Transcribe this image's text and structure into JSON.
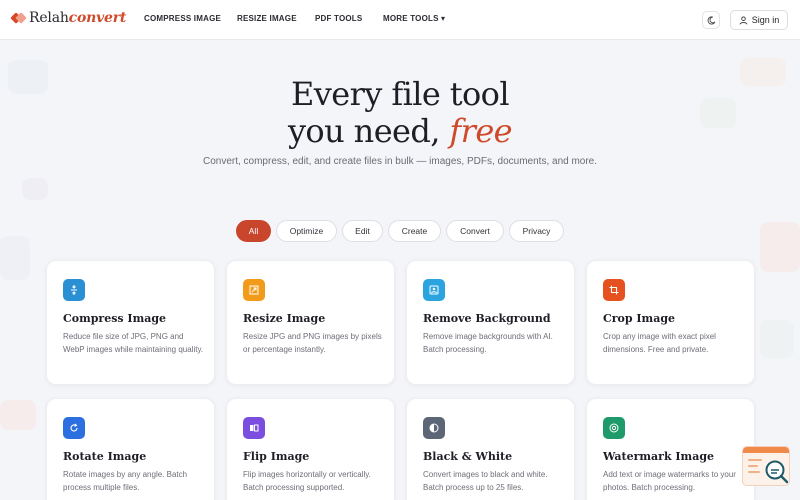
{
  "brand": {
    "name_plain": "Relah",
    "name_accent": "convert"
  },
  "nav": {
    "items": [
      "COMPRESS IMAGE",
      "RESIZE IMAGE",
      "PDF TOOLS",
      "MORE TOOLS ▾"
    ],
    "sign_in": "Sign in",
    "theme_toggle_icon": "moon-icon",
    "sign_in_icon": "user-icon"
  },
  "hero": {
    "line1": "Every file tool",
    "line2_plain": "you need,",
    "line2_accent": "free",
    "subtitle": "Convert, compress, edit, and create files in bulk — images, PDFs, documents, and more."
  },
  "filters": {
    "items": [
      "All",
      "Optimize",
      "Edit",
      "Create",
      "Convert",
      "Privacy"
    ],
    "active": "All"
  },
  "tools": [
    {
      "title": "Compress Image",
      "desc": "Reduce file size of JPG, PNG and WebP images while maintaining quality.",
      "icon": "compress-icon",
      "color": "#2b8fd4"
    },
    {
      "title": "Resize Image",
      "desc": "Resize JPG and PNG images by pixels or percentage instantly.",
      "icon": "resize-icon",
      "color": "#f29a1a"
    },
    {
      "title": "Remove Background",
      "desc": "Remove image backgrounds with AI. Batch processing.",
      "icon": "image-icon",
      "color": "#2ba3df"
    },
    {
      "title": "Crop Image",
      "desc": "Crop any image with exact pixel dimensions. Free and private.",
      "icon": "crop-icon",
      "color": "#e5521f"
    },
    {
      "title": "Rotate Image",
      "desc": "Rotate images by any angle. Batch process multiple files.",
      "icon": "rotate-icon",
      "color": "#2c6fe0"
    },
    {
      "title": "Flip Image",
      "desc": "Flip images horizontally or vertically. Batch processing supported.",
      "icon": "flip-icon",
      "color": "#7b4ee0"
    },
    {
      "title": "Black & White",
      "desc": "Convert images to black and white. Batch process up to 25 files.",
      "icon": "contrast-icon",
      "color": "#5d6677"
    },
    {
      "title": "Watermark Image",
      "desc": "Add text or image watermarks to your photos. Batch processing.",
      "icon": "watermark-icon",
      "color": "#1f9a6a"
    }
  ],
  "colors": {
    "accent": "#cf4a2b",
    "active_chip": "#c9462c"
  },
  "widget": {
    "icon": "search-help-icon"
  }
}
